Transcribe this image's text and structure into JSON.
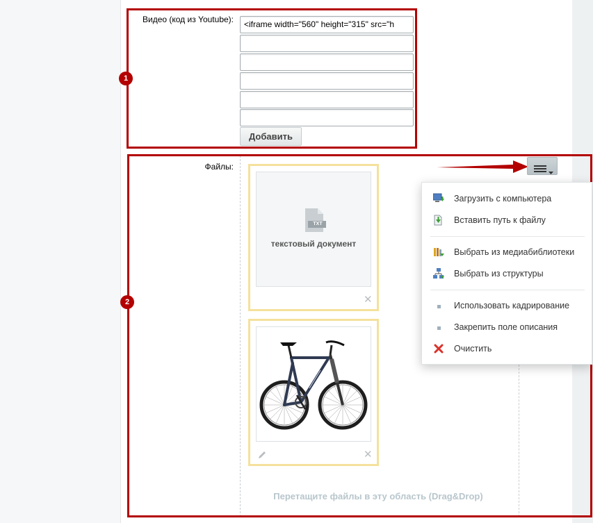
{
  "video": {
    "label": "Видео (код из Youtube):",
    "inputs": [
      "<iframe width=\"560\" height=\"315\" src=\"h",
      "",
      "",
      "",
      ""
    ],
    "add_button": "Добавить"
  },
  "files": {
    "label": "Файлы:",
    "items": [
      {
        "type": "document",
        "badge": "TXT",
        "name": "текстовый документ"
      },
      {
        "type": "image",
        "name": "bicycle"
      }
    ],
    "drop_hint": "Перетащите файлы в эту область (Drag&Drop)"
  },
  "annotations": {
    "box1": "1",
    "box2": "2"
  },
  "menu": {
    "items": [
      {
        "label": "Загрузить с компьютера",
        "icon": "computer-upload-icon"
      },
      {
        "label": "Вставить путь к файлу",
        "icon": "file-path-icon"
      },
      {
        "label": "Выбрать из медиабиблиотеки",
        "icon": "media-library-icon"
      },
      {
        "label": "Выбрать из структуры",
        "icon": "structure-icon"
      },
      {
        "label": "Использовать кадрирование",
        "icon": "bullet-icon"
      },
      {
        "label": "Закрепить поле описания",
        "icon": "bullet-icon"
      },
      {
        "label": "Очистить",
        "icon": "clear-icon"
      }
    ]
  },
  "colors": {
    "annotation": "#b30000",
    "card_border": "#f5e19c",
    "drop_hint": "#b8c6cc"
  }
}
